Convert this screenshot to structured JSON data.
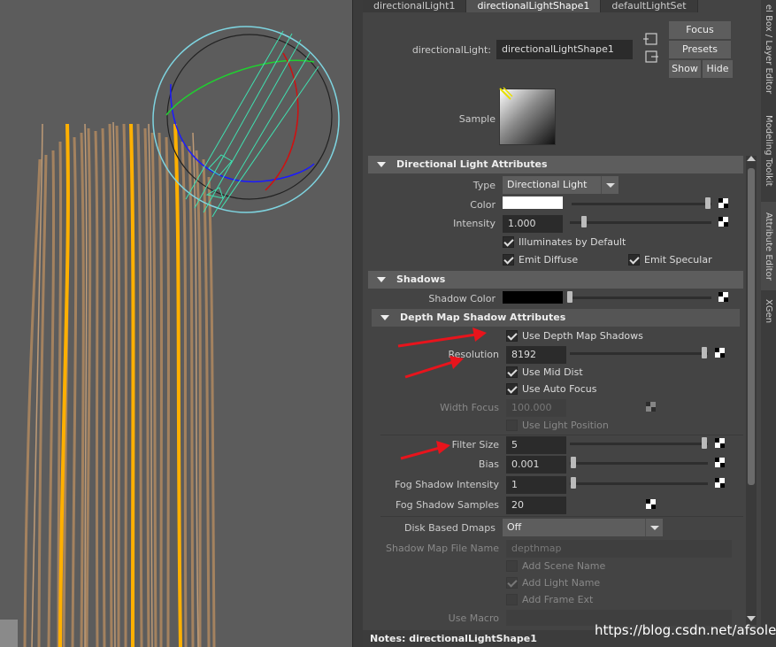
{
  "tabs": [
    "directionalLight1",
    "directionalLightShape1",
    "defaultLightSet"
  ],
  "header": {
    "node_label": "directionalLight:",
    "node_value": "directionalLightShape1",
    "focus": "Focus",
    "presets": "Presets",
    "show": "Show",
    "hide": "Hide",
    "sample_label": "Sample"
  },
  "side_tabs": [
    "el Box / Layer Editor",
    "Modeling Toolkit",
    "Attribute Editor",
    "XGen"
  ],
  "directional": {
    "title": "Directional Light Attributes",
    "type_label": "Type",
    "type_value": "Directional Light",
    "color_label": "Color",
    "color_value": "#ffffff",
    "intensity_label": "Intensity",
    "intensity_value": "1.000",
    "illuminates": "Illuminates by Default",
    "emit_diffuse": "Emit Diffuse",
    "emit_specular": "Emit Specular"
  },
  "shadows": {
    "title": "Shadows",
    "shadow_color_label": "Shadow Color",
    "shadow_color_value": "#000000",
    "depth_title": "Depth Map Shadow Attributes",
    "use_depth_map": "Use Depth Map Shadows",
    "resolution_label": "Resolution",
    "resolution_value": "8192",
    "use_mid_dist": "Use Mid Dist",
    "use_auto_focus": "Use Auto Focus",
    "width_focus_label": "Width Focus",
    "width_focus_value": "100.000",
    "use_light_position": "Use Light Position",
    "filter_size_label": "Filter Size",
    "filter_size_value": "5",
    "bias_label": "Bias",
    "bias_value": "0.001",
    "fog_intensity_label": "Fog Shadow Intensity",
    "fog_intensity_value": "1",
    "fog_samples_label": "Fog Shadow Samples",
    "fog_samples_value": "20",
    "disk_label": "Disk Based Dmaps",
    "disk_value": "Off",
    "file_label": "Shadow Map File Name",
    "file_value": "depthmap",
    "add_scene": "Add Scene Name",
    "add_light": "Add Light Name",
    "add_frame": "Add Frame Ext",
    "use_macro_label": "Use Macro"
  },
  "notes": {
    "label": "Notes:",
    "value": "directionalLightShape1"
  },
  "watermark": "https://blog.csdn.net/afsoler",
  "colors": {
    "hair_main": "#a0805a",
    "hair_highlight": "#ffb000",
    "light_gizmo": "#40e0d0",
    "arrows": "#e8141c"
  }
}
